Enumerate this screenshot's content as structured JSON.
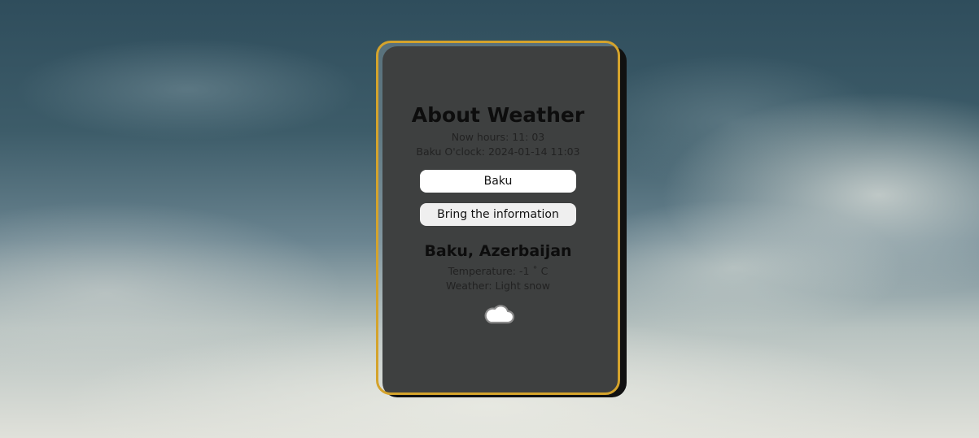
{
  "header": {
    "title": "About Weather",
    "now_hours": "Now hours: 11: 03",
    "city_clock": "Baku O'clock: 2024-01-14 11:03"
  },
  "form": {
    "city_input_value": "Baku",
    "fetch_button_label": "Bring the information"
  },
  "result": {
    "location": "Baku, Azerbaijan",
    "temperature": "Temperature: -1 ˚ C",
    "weather": "Weather: Light snow",
    "icon": "cloud-icon"
  },
  "colors": {
    "card_border": "#d4a32c",
    "card_shadow": "#111111",
    "sky_top": "#2f4d5c",
    "sky_bottom": "#e0e1da"
  }
}
